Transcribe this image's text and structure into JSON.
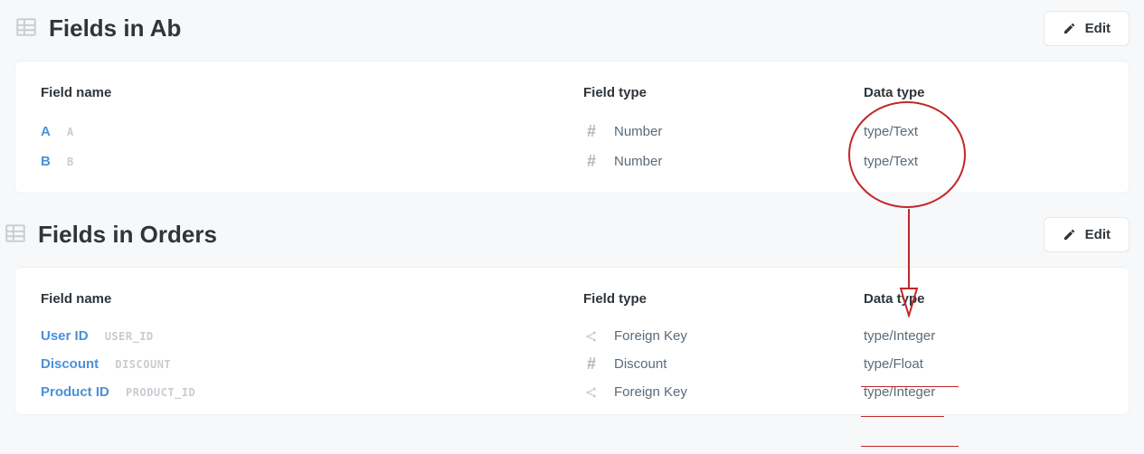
{
  "buttons": {
    "edit_label": "Edit"
  },
  "columns": {
    "field_name": "Field name",
    "field_type": "Field type",
    "data_type": "Data type"
  },
  "sections": [
    {
      "title": "Fields in Ab",
      "rows": [
        {
          "name": "A",
          "db": "a",
          "ftype_icon": "hash",
          "ftype": "Number",
          "dtype": "type/Text"
        },
        {
          "name": "B",
          "db": "b",
          "ftype_icon": "hash",
          "ftype": "Number",
          "dtype": "type/Text"
        }
      ]
    },
    {
      "title": "Fields in Orders",
      "rows": [
        {
          "name": "User ID",
          "db": "USER_ID",
          "ftype_icon": "fk",
          "ftype": "Foreign Key",
          "dtype": "type/Integer"
        },
        {
          "name": "Discount",
          "db": "DISCOUNT",
          "ftype_icon": "hash",
          "ftype": "Discount",
          "dtype": "type/Float"
        },
        {
          "name": "Product ID",
          "db": "PRODUCT_ID",
          "ftype_icon": "fk",
          "ftype": "Foreign Key",
          "dtype": "type/Integer"
        }
      ]
    }
  ]
}
